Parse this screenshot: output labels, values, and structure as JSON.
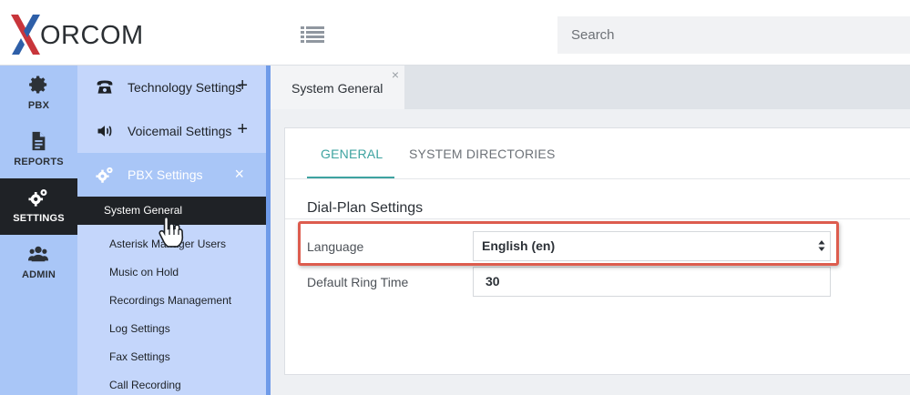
{
  "brand": {
    "logo_text": "ORCOM",
    "logo_colors": {
      "red": "#c8353b",
      "blue": "#2e5fa8"
    }
  },
  "header": {
    "search_placeholder": "Search",
    "menu_icon": "list-icon"
  },
  "rail": {
    "items": [
      {
        "label": "PBX",
        "icon": "gear-icon",
        "active": false
      },
      {
        "label": "REPORTS",
        "icon": "document-icon",
        "active": false
      },
      {
        "label": "SETTINGS",
        "icon": "gears-icon",
        "active": true
      },
      {
        "label": "ADMIN",
        "icon": "users-icon",
        "active": false
      }
    ]
  },
  "subnav": {
    "sections": [
      {
        "label": "Technology Settings",
        "icon": "phone-icon",
        "toggle": "+"
      },
      {
        "label": "Voicemail Settings",
        "icon": "speaker-icon",
        "toggle": "+"
      },
      {
        "label": "PBX Settings",
        "icon": "gears-icon",
        "toggle": "×",
        "expanded": true
      }
    ],
    "links": [
      {
        "label": "System General",
        "active": true
      },
      {
        "label": "Asterisk Manager Users"
      },
      {
        "label": "Music on Hold"
      },
      {
        "label": "Recordings Management"
      },
      {
        "label": "Log Settings"
      },
      {
        "label": "Fax Settings"
      },
      {
        "label": "Call Recording"
      }
    ]
  },
  "main": {
    "page_tab": {
      "label": "System General",
      "close": "×"
    },
    "panel_tabs": [
      {
        "label": "GENERAL",
        "active": true
      },
      {
        "label": "SYSTEM DIRECTORIES",
        "active": false
      }
    ],
    "section_title": "Dial-Plan Settings",
    "fields": {
      "language": {
        "label": "Language",
        "value": "English (en)"
      },
      "ring_time": {
        "label": "Default Ring Time",
        "value": "30"
      }
    }
  },
  "colors": {
    "rail_bg": "#a9c6f7",
    "subnav_bg": "#c4d6fb",
    "active_dark": "#1f2226",
    "tab_accent": "#3ea3a0",
    "highlight": "#dd5c4e"
  }
}
